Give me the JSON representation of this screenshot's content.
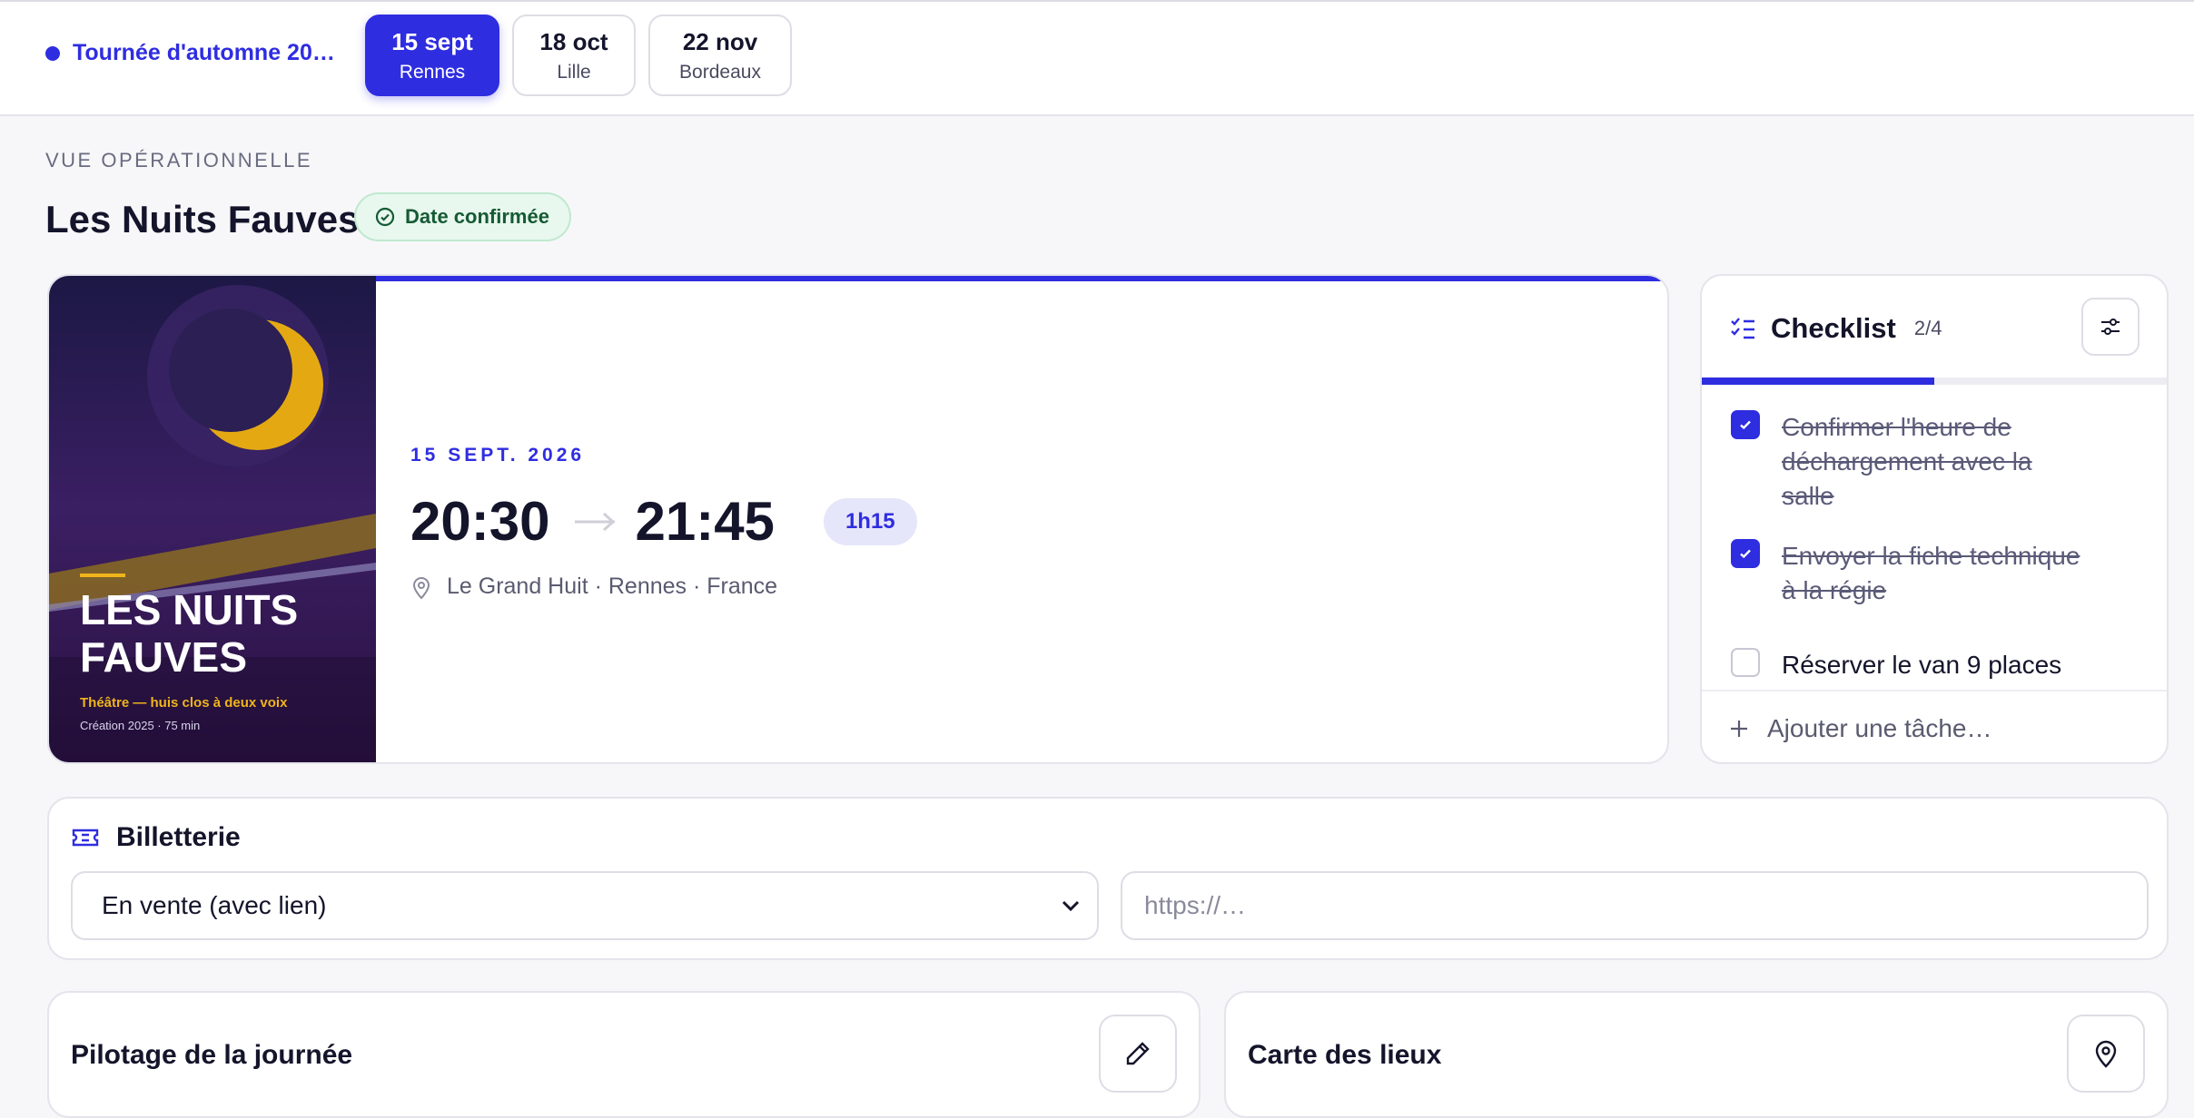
{
  "tour": {
    "name": "Tournée d'automne 20…",
    "accent": "#2f2de0"
  },
  "dates": [
    {
      "day": "15 sept",
      "city": "Rennes",
      "active": true
    },
    {
      "day": "18 oct",
      "city": "Lille",
      "active": false
    },
    {
      "day": "22 nov",
      "city": "Bordeaux",
      "active": false
    }
  ],
  "header": {
    "kicker": "VUE OPÉRATIONNELLE",
    "title": "Les Nuits Fauves",
    "status": "Date confirmée"
  },
  "event": {
    "date": "15 SEPT. 2026",
    "start": "20:30",
    "end": "21:45",
    "duration": "1h15",
    "venue": "Le Grand Huit · Rennes · France"
  },
  "poster": {
    "title_line1": "LES NUITS",
    "title_line2": "FAUVES",
    "subtitle": "Théâtre — huis clos à deux voix",
    "info": "Création 2025 · 75 min"
  },
  "checklist": {
    "label": "Checklist",
    "count": "2/4",
    "progress": 0.5,
    "items": [
      {
        "text": "Confirmer l'heure de déchargement avec la salle",
        "done": true
      },
      {
        "text": "Envoyer la fiche technique à la régie",
        "done": true
      },
      {
        "text": "Réserver le van 9 places",
        "done": false
      }
    ],
    "add_label": "Ajouter une tâche…"
  },
  "ticketing": {
    "label": "Billetterie",
    "selected": "En vente (avec lien)",
    "url_placeholder": "https://…"
  },
  "panels": {
    "day_title": "Pilotage de la journée",
    "map_title": "Carte des lieux"
  }
}
